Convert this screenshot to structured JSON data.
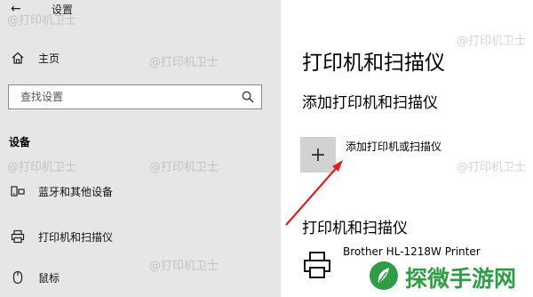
{
  "window": {
    "title": "设置"
  },
  "sidebar": {
    "home": "主页",
    "search_placeholder": "查找设置",
    "section": "设备",
    "items": [
      {
        "label": "蓝牙和其他设备",
        "icon": "bluetooth-devices-icon"
      },
      {
        "label": "打印机和扫描仪",
        "icon": "printer-icon"
      },
      {
        "label": "鼠标",
        "icon": "mouse-icon"
      }
    ]
  },
  "main": {
    "title": "打印机和扫描仪",
    "add_section_title": "添加打印机和扫描仪",
    "add_label": "添加打印机或扫描仪",
    "list_title": "打印机和扫描仪",
    "printer_name": "Brother HL-1218W Printer"
  },
  "watermark": "@打印机卫士",
  "brand": {
    "name": "探微手游网"
  },
  "colors": {
    "arrow": "#e02020",
    "brand": "#2f9d46"
  }
}
